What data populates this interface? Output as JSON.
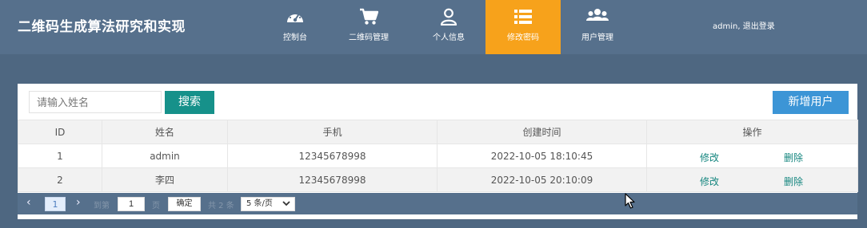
{
  "app": {
    "title": "二维码生成算法研究和实现"
  },
  "nav": {
    "items": [
      {
        "label": "控制台",
        "icon": "dashboard-icon"
      },
      {
        "label": "二维码管理",
        "icon": "cart-icon"
      },
      {
        "label": "个人信息",
        "icon": "user-icon"
      },
      {
        "label": "修改密码",
        "icon": "list-icon",
        "active": true
      },
      {
        "label": "用户管理",
        "icon": "users-icon"
      }
    ]
  },
  "user": {
    "name": "admin,",
    "logout": " 退出登录"
  },
  "toolbar": {
    "search_placeholder": "请输入姓名",
    "search_label": "搜索",
    "add_label": "新增用户"
  },
  "table": {
    "headers": [
      "ID",
      "姓名",
      "手机",
      "创建时间",
      "操作"
    ],
    "rows": [
      {
        "id": "1",
        "name": "admin",
        "phone": "12345678998",
        "created": "2022-10-05 18:10:45",
        "edit": "修改",
        "delete": "删除"
      },
      {
        "id": "2",
        "name": "李四",
        "phone": "12345678998",
        "created": "2022-10-05 20:10:09",
        "edit": "修改",
        "delete": "删除"
      }
    ]
  },
  "pagination": {
    "current_page": "1",
    "goto_label": "到第",
    "goto_value": "1",
    "page_unit": "页",
    "confirm_label": "确定",
    "total_label": "共 2 条",
    "page_size": "5 条/页"
  },
  "colors": {
    "background": "#4e6781",
    "topbar": "#56708c",
    "active_nav": "#f7a21b",
    "search_button": "#16918a",
    "add_button": "#3c95d6",
    "action_link": "#15867f"
  }
}
